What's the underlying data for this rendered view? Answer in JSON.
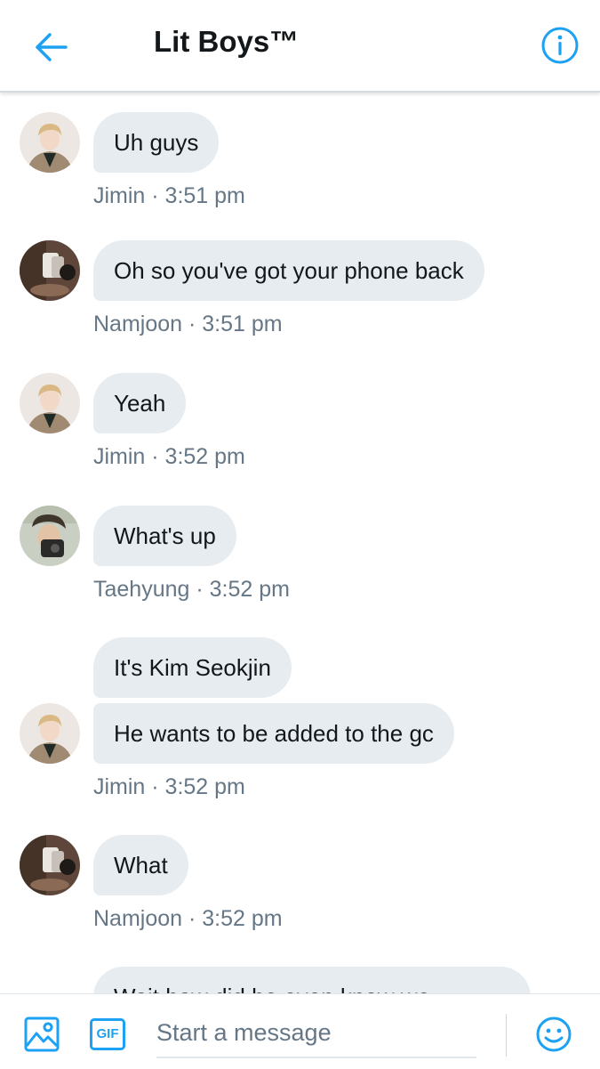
{
  "header": {
    "title": "Lit Boys™"
  },
  "messages": [
    {
      "text": "Uh guys",
      "meta": "Jimin · 3:51 pm"
    },
    {
      "text": "Oh so you've got your phone back",
      "meta": "Namjoon · 3:51 pm"
    },
    {
      "text": "Yeah",
      "meta": "Jimin · 3:52 pm"
    },
    {
      "text": "What's up",
      "meta": "Taehyung · 3:52 pm"
    },
    {
      "text": "It's Kim Seokjin"
    },
    {
      "text": "He wants to be added to the gc",
      "meta": "Jimin · 3:52 pm"
    },
    {
      "text": "What",
      "meta": "Namjoon · 3:52 pm"
    },
    {
      "text": "Wait how did he even know we"
    }
  ],
  "composer": {
    "placeholder": "Start a message",
    "gif_label": "GIF"
  },
  "colors": {
    "accent": "#1da1f2",
    "bubble": "#e6ecf0",
    "meta": "#657786"
  },
  "icons": [
    "back-arrow-icon",
    "info-icon",
    "image-icon",
    "gif-icon",
    "emoji-icon"
  ]
}
